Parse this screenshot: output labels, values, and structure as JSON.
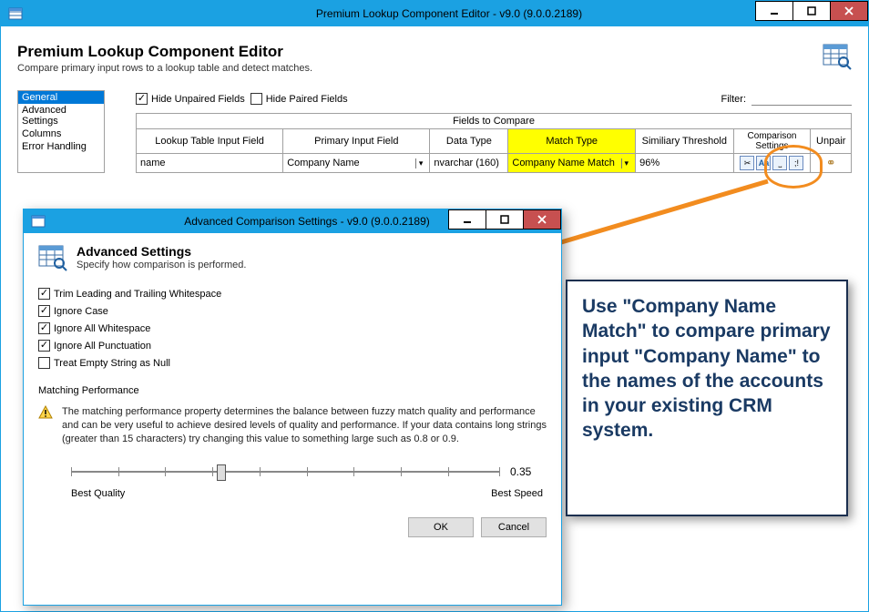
{
  "window": {
    "title": "Premium Lookup Component Editor - v9.0 (9.0.0.2189)"
  },
  "header": {
    "title": "Premium Lookup Component Editor",
    "subtitle": "Compare primary input rows to a lookup table and detect matches."
  },
  "nav": {
    "items": [
      "General",
      "Advanced Settings",
      "Columns",
      "Error Handling"
    ]
  },
  "filter": {
    "hide_unpaired": "Hide Unpaired Fields",
    "hide_paired": "Hide Paired Fields",
    "filter_label": "Filter:"
  },
  "grid": {
    "banner": "Fields to Compare",
    "cols": [
      "Lookup Table Input Field",
      "Primary Input Field",
      "Data Type",
      "Match Type",
      "Similiary Threshold",
      "Comparison Settings",
      "Unpair"
    ],
    "row": {
      "lookup": "name",
      "primary": "Company Name",
      "datatype": "nvarchar (160)",
      "matchtype": "Company Name Match",
      "threshold": "96%"
    }
  },
  "dialog": {
    "title": "Advanced Comparison Settings - v9.0 (9.0.0.2189)",
    "heading": "Advanced Settings",
    "subtitle": "Specify how comparison is performed.",
    "opts": [
      "Trim Leading and Trailing Whitespace",
      "Ignore Case",
      "Ignore All Whitespace",
      "Ignore All Punctuation",
      "Treat Empty String as Null"
    ],
    "section": "Matching Performance",
    "perf_text": "The matching performance property determines the balance between fuzzy match quality and performance and can be very useful to achieve desired levels of quality and performance. If your data contains long strings (greater than 15 characters) try changing this value to something large such as 0.8 or 0.9.",
    "slider_value": "0.35",
    "best_quality": "Best Quality",
    "best_speed": "Best Speed",
    "ok": "OK",
    "cancel": "Cancel"
  },
  "callout": {
    "text": "Use \"Company Name Match\" to compare primary input \"Company Name\" to the names of the accounts in your existing CRM system."
  }
}
